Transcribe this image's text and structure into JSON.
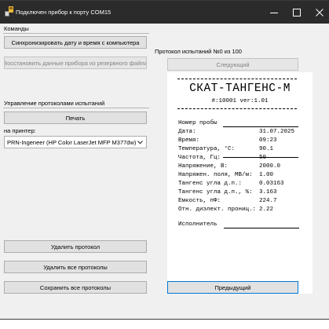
{
  "window": {
    "title": "Подключен прибор к порту COM15"
  },
  "left": {
    "commands_label": "Команды",
    "sync_button": "Синхронизировать  дату и время с компьютера",
    "restore_button": "Восстановить данные прибора из резервного файла",
    "protocols_label": "Управление протоколами испытаний",
    "print_button": "Печать",
    "printer_label": "на принтер:",
    "printer_value": "PRN-Ingeneer (HP Color LaserJet MFP M377dw)",
    "delete_button": "Удалить протокол",
    "delete_all_button": "Удалить все протоколы",
    "save_all_button": "Сохранить все протоколы"
  },
  "right": {
    "protocol_label": "Протокол испытаний №0 из 100",
    "next_button": "Следующий",
    "prev_button": "Предыдущий"
  },
  "receipt": {
    "title": "СКАТ-ТАНГЕНС-М",
    "serial": "#:10001 ver:1.01",
    "sample_label": "Номер пробы",
    "rows": [
      {
        "key": "Дата:",
        "value": "31.07.2025"
      },
      {
        "key": "Время:",
        "value": "09:23"
      },
      {
        "key": "Температура, °С:",
        "value": "90.1"
      },
      {
        "key": "Частота, Гц:",
        "value": "50"
      },
      {
        "key": "Напряжение, В:",
        "value": "2000.0"
      },
      {
        "key": "Напряжен. поля, МВ/м:",
        "value": "1.00"
      },
      {
        "key": "Тангенс угла д.п.:",
        "value": "0.03163"
      },
      {
        "key": "Тангенс угла д.п., %:",
        "value": "3.163"
      },
      {
        "key": "Емкость, пФ:",
        "value": "224.7"
      },
      {
        "key": "Отн. диэлект. прониц.:",
        "value": "2.22"
      }
    ],
    "executor_label": "Исполнитель"
  }
}
